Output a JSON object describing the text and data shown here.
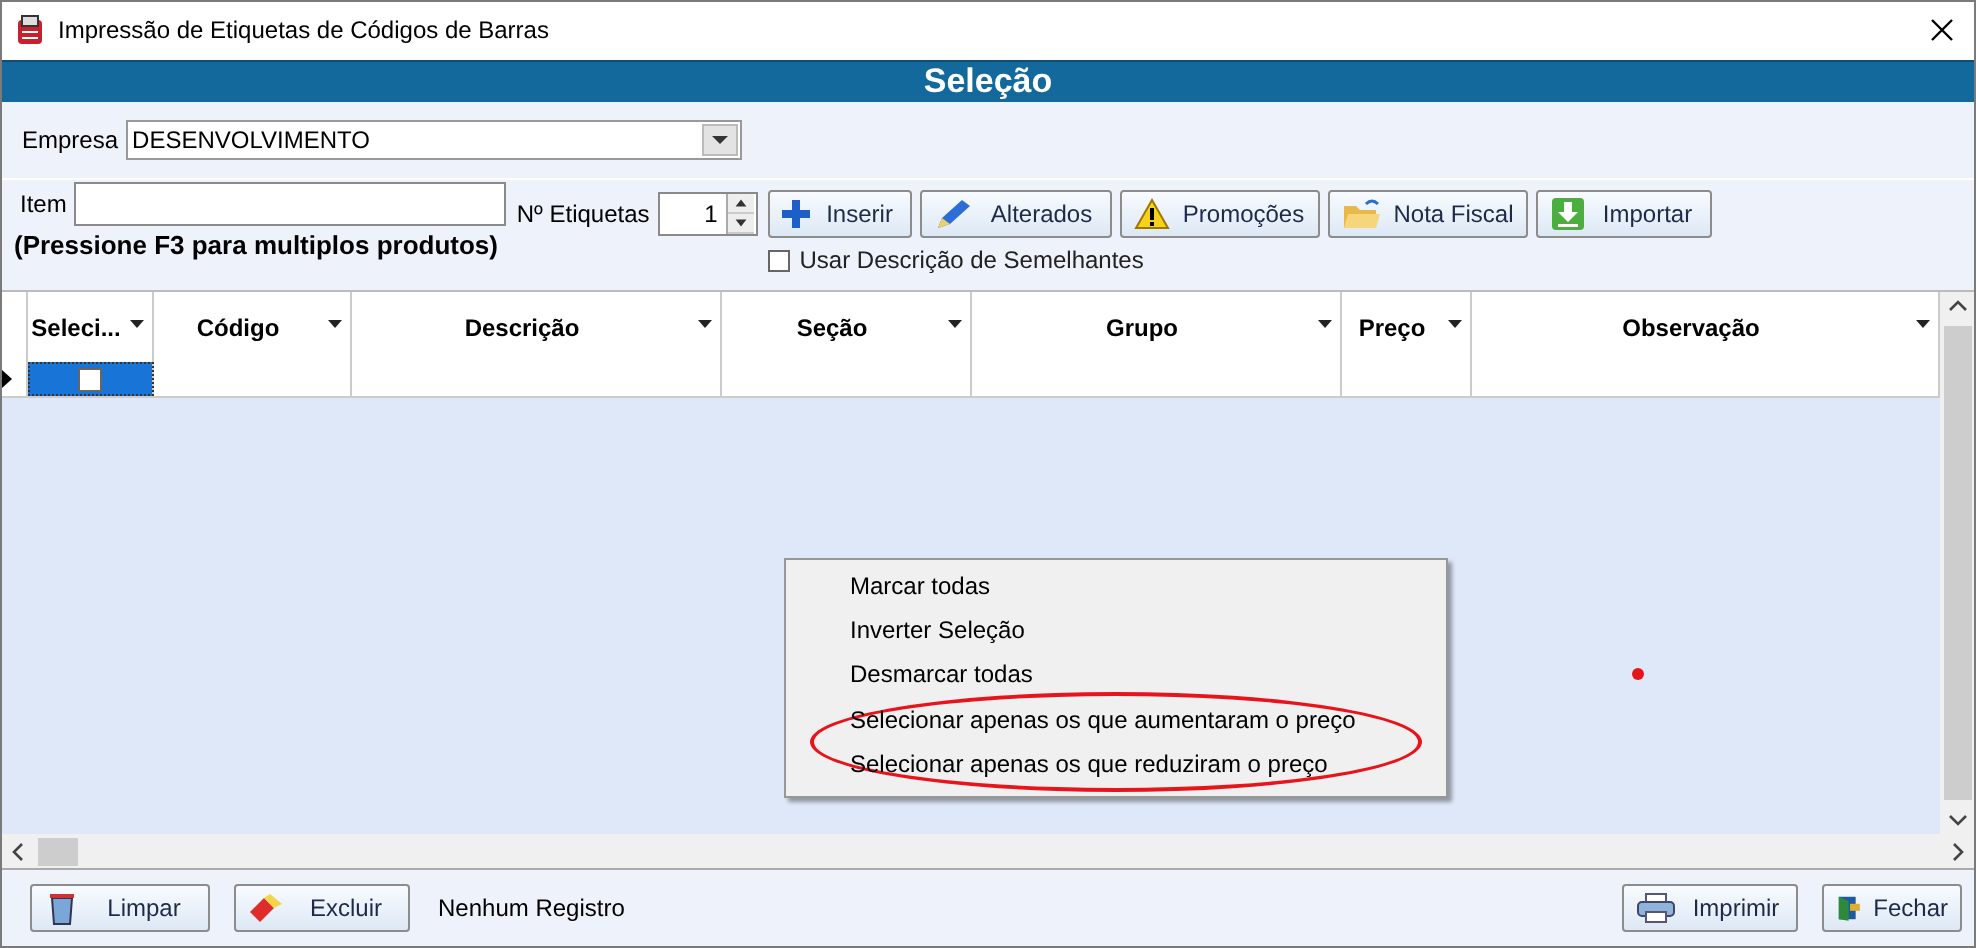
{
  "window": {
    "title": "Impressão de Etiquetas de Códigos de Barras"
  },
  "header": {
    "title": "Seleção"
  },
  "empresa": {
    "label": "Empresa",
    "value": "DESENVOLVIMENTO"
  },
  "item": {
    "label": "Item",
    "hint": "(Pressione F3 para multiplos produtos)"
  },
  "etiquetas": {
    "label": "Nº Etiquetas",
    "value": "1"
  },
  "toolbar": [
    {
      "label": "Inserir"
    },
    {
      "label": "Alterados"
    },
    {
      "label": "Promoções"
    },
    {
      "label": "Nota Fiscal"
    },
    {
      "label": "Importar"
    }
  ],
  "similar": {
    "label": "Usar Descrição de Semelhantes",
    "checked": false
  },
  "table": {
    "columns": [
      "Seleci...",
      "Código",
      "Descrição",
      "Seção",
      "Grupo",
      "Preço",
      "Observação"
    ],
    "rows": [
      {
        "current": true,
        "checked": false
      }
    ]
  },
  "context_menu": {
    "items": [
      {
        "label": "Marcar todas",
        "circled": false
      },
      {
        "label": "Inverter Seleção",
        "circled": false
      },
      {
        "label": "Desmarcar todas",
        "circled": false
      },
      {
        "label": "Selecionar apenas os que aumentaram o preço",
        "circled": true
      },
      {
        "label": "Selecionar apenas os que reduziram o preço",
        "circled": true
      }
    ]
  },
  "footer": {
    "left_buttons": [
      {
        "label": "Limpar"
      },
      {
        "label": "Excluir"
      }
    ],
    "status": "Nenhum Registro",
    "right_buttons": [
      {
        "label": "Imprimir"
      },
      {
        "label": "Fechar"
      }
    ]
  }
}
